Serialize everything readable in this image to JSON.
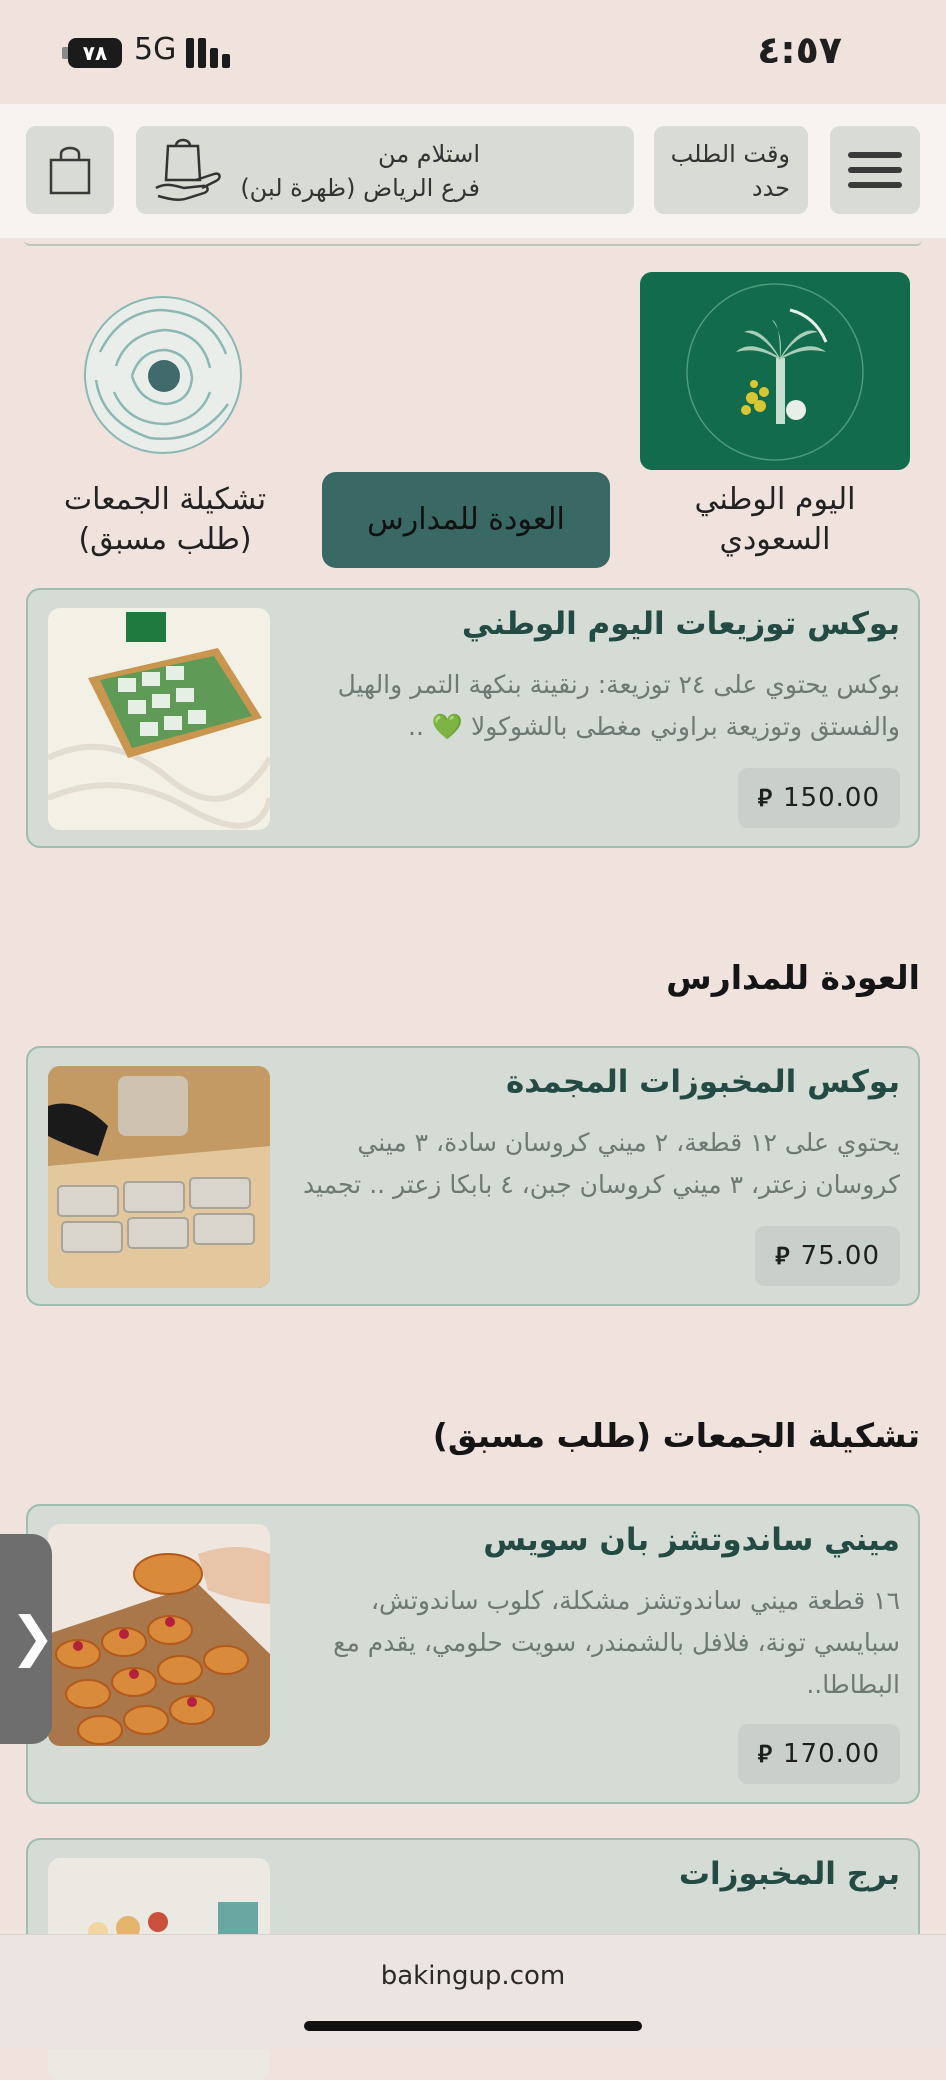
{
  "status_bar": {
    "battery": "٧٨",
    "network": "5G",
    "time": "٤:٥٧"
  },
  "header": {
    "menu_icon": "hamburger-menu-icon",
    "order_time": {
      "line1": "وقت الطلب",
      "line2": "حدد"
    },
    "pickup": {
      "line1": "استلام من",
      "line2": "فرع الرياض (ظهرة لبن)",
      "icon": "pickup-bag-icon"
    },
    "cart_icon": "shopping-bag-icon"
  },
  "categories": [
    {
      "label_line1": "اليوم الوطني",
      "label_line2": "السعودي",
      "image": "palm-tree-national-day"
    },
    {
      "label": "العودة للمدارس",
      "active": true
    },
    {
      "label_line1": "تشكيلة الجمعات",
      "label_line2": "(طلب مسبق)",
      "image": "swirl-logo"
    }
  ],
  "sections": [
    {
      "products": [
        {
          "title": "بوكس توزيعات اليوم الوطني",
          "desc": "بوكس يحتوي على ٢٤ توزيعة: رنقينة بنكهة التمر والهيل والفستق وتوزيعة براوني مغطى بالشوكولا 💚 ..",
          "price": "150.00"
        }
      ]
    },
    {
      "title": "العودة للمدارس",
      "products": [
        {
          "title": "بوكس المخبوزات المجمدة",
          "desc": "يحتوي على ١٢ قطعة، ٢ ميني كروسان سادة، ٣ ميني كروسان زعتر، ٣ ميني كروسان جبن، ٤ بابكا زعتر .. تجميد ..",
          "price": "75.00"
        }
      ]
    },
    {
      "title": "تشكيلة الجمعات (طلب مسبق)",
      "products": [
        {
          "title": "ميني ساندوتشز بان سويس",
          "desc": "١٦ قطعة ميني ساندوتشز مشكلة، كلوب ساندوتش، سبايسي تونة، فلافل بالشمندر، سويت حلومي، يقدم مع البطاطا..",
          "price": "170.00"
        },
        {
          "title": "برج المخبوزات"
        }
      ]
    }
  ],
  "currency_symbol": "⃁",
  "side_tab_icon": "chevron-right-icon",
  "browser": {
    "url": "bakingup.com"
  },
  "colors": {
    "accent": "#3a6864",
    "brand_green": "#126b4c",
    "card_bg": "#d5dbd5",
    "card_border": "#9fbdb1",
    "page_bg": "#f0e3dd"
  }
}
